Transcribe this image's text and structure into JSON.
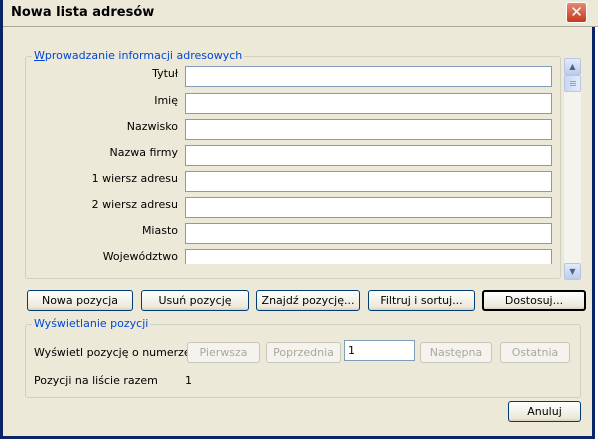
{
  "window": {
    "title": "Nowa lista adresów",
    "close_label": "✕"
  },
  "entry": {
    "legend_accesskey": "W",
    "legend_rest": "prowadzanie informacji adresowych",
    "fields": [
      {
        "label": "Tytuł",
        "value": ""
      },
      {
        "label": "Imię",
        "value": ""
      },
      {
        "label": "Nazwisko",
        "value": ""
      },
      {
        "label": "Nazwa firmy",
        "value": ""
      },
      {
        "label": "1 wiersz adresu",
        "value": ""
      },
      {
        "label": "2 wiersz adresu",
        "value": ""
      },
      {
        "label": "Miasto",
        "value": ""
      },
      {
        "label": "Województwo",
        "value": ""
      }
    ]
  },
  "scrollbar": {
    "up_glyph": "▲",
    "down_glyph": "▼"
  },
  "actions": {
    "new": "Nowa pozycja",
    "delete": "Usuń pozycję",
    "find": "Znajdź pozycję...",
    "filter": "Filtruj i sortuj...",
    "customize": "Dostosuj..."
  },
  "display": {
    "legend": "Wyświetlanie pozycji",
    "show_label": "Wyświetl pozycję o numerze",
    "first": "Pierwsza",
    "previous": "Poprzednia",
    "number": "1",
    "next": "Następna",
    "last": "Ostatnia",
    "total_label": "Pozycji na liście razem",
    "total_value": "1"
  },
  "footer": {
    "cancel": "Anuluj"
  }
}
